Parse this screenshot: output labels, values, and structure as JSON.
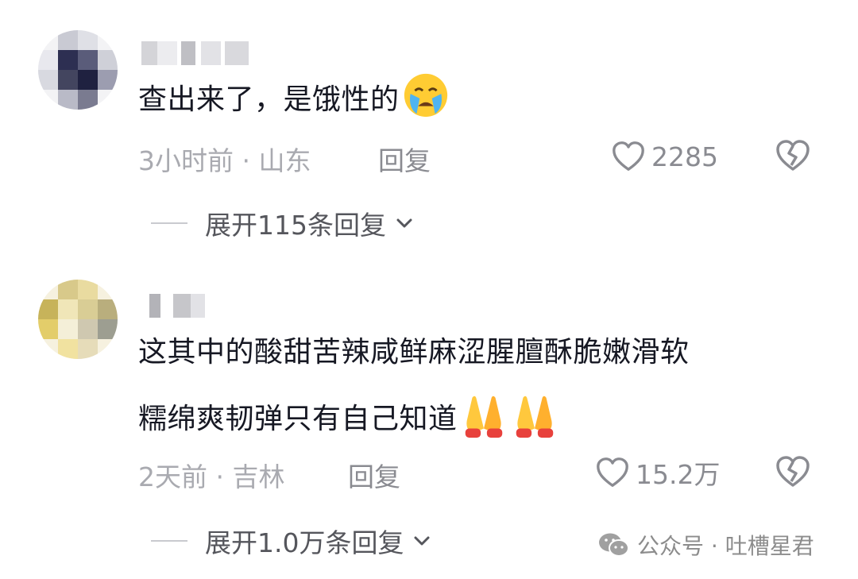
{
  "comments": [
    {
      "text": "查出来了，是饿性的",
      "emoji": "loudly-crying-face-emoji",
      "time": "3小时前",
      "location": "山东",
      "separator": " · ",
      "reply_label": "回复",
      "likes": "2285",
      "expand_label": "展开115条回复"
    },
    {
      "text_line1": "这其中的酸甜苦辣咸鲜麻涩腥膻酥脆嫩滑软",
      "text_line2": "糯绵爽韧弹只有自己知道",
      "emoji": "folded-hands-emoji",
      "time": "2天前",
      "location": "吉林",
      "separator": " · ",
      "reply_label": "回复",
      "likes": "15.2万",
      "expand_label": "展开1.0万条回复"
    }
  ],
  "watermark": {
    "text": "公众号 · 吐槽星君",
    "icon": "wechat-icon"
  },
  "colors": {
    "primary_text": "#161823",
    "meta_text": "#a9aab0",
    "action_text": "#8a8b91"
  }
}
